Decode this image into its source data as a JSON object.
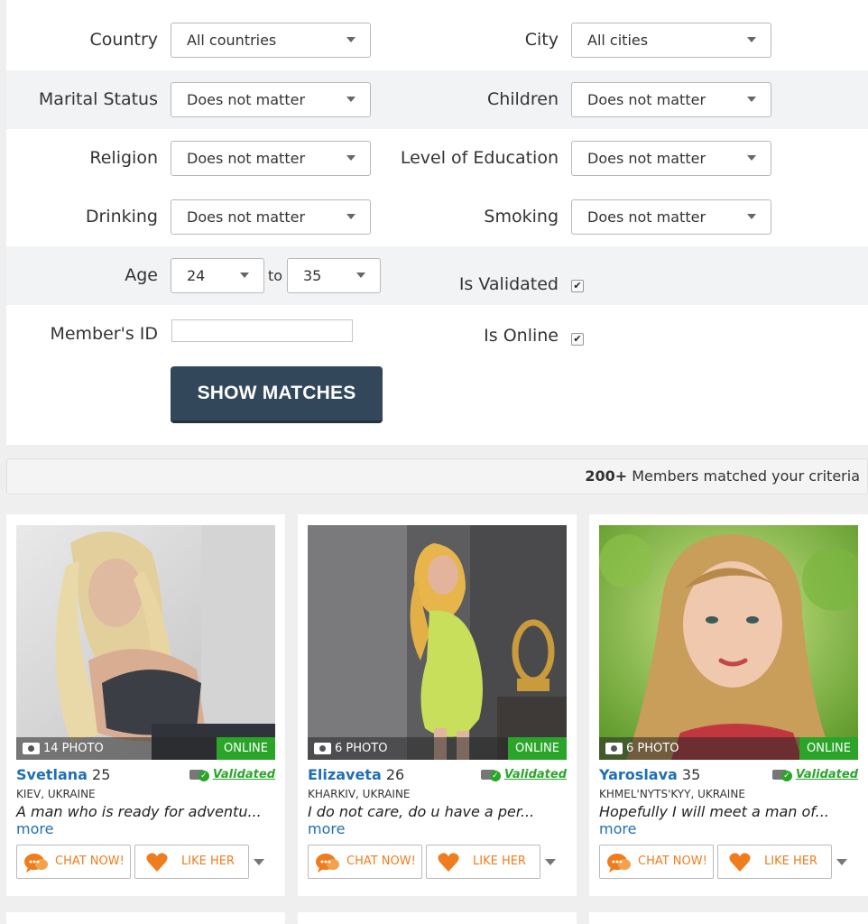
{
  "filters": {
    "country": {
      "label": "Country",
      "value": "All countries"
    },
    "city": {
      "label": "City",
      "value": "All cities"
    },
    "marital_status": {
      "label": "Marital Status",
      "value": "Does not matter"
    },
    "children": {
      "label": "Children",
      "value": "Does not matter"
    },
    "religion": {
      "label": "Religion",
      "value": "Does not matter"
    },
    "education": {
      "label": "Level of Education",
      "value": "Does not matter"
    },
    "drinking": {
      "label": "Drinking",
      "value": "Does not matter"
    },
    "smoking": {
      "label": "Smoking",
      "value": "Does not matter"
    },
    "age": {
      "label": "Age",
      "from": "24",
      "to_label": "to",
      "to": "35"
    },
    "validated": {
      "label": "Is Validated",
      "checked": true
    },
    "member_id": {
      "label": "Member's ID",
      "value": ""
    },
    "online": {
      "label": "Is Online",
      "checked": true
    },
    "submit_label": "SHOW MATCHES"
  },
  "results": {
    "count": "200+",
    "text": " Members matched your criteria"
  },
  "members": [
    {
      "name": "Svetlana",
      "age": "25",
      "location": "KIEV, UKRAINE",
      "description": "A man who is ready for adventu...",
      "more": "more",
      "photo_count": "14 PHOTO",
      "status": "ONLINE",
      "validated": "Validated",
      "chat_label": "CHAT NOW!",
      "like_label": "LIKE HER"
    },
    {
      "name": "Elizaveta",
      "age": "26",
      "location": "KHARKIV, UKRAINE",
      "description": "I do not care, do u have a per...",
      "more": "more",
      "photo_count": "6 PHOTO",
      "status": "ONLINE",
      "validated": "Validated",
      "chat_label": "CHAT NOW!",
      "like_label": "LIKE HER"
    },
    {
      "name": "Yaroslava",
      "age": "35",
      "location": "KHMEL'NYTS'KYY, UKRAINE",
      "description": "Hopefully I will meet a man of...",
      "more": "more",
      "photo_count": "6 PHOTO",
      "status": "ONLINE",
      "validated": "Validated",
      "chat_label": "CHAT NOW!",
      "like_label": "LIKE HER"
    }
  ],
  "colors": {
    "link_blue": "#1f6fb4",
    "online_green": "#2aa52a",
    "accent_orange": "#ef7d1e",
    "button_dark": "#33475b"
  }
}
